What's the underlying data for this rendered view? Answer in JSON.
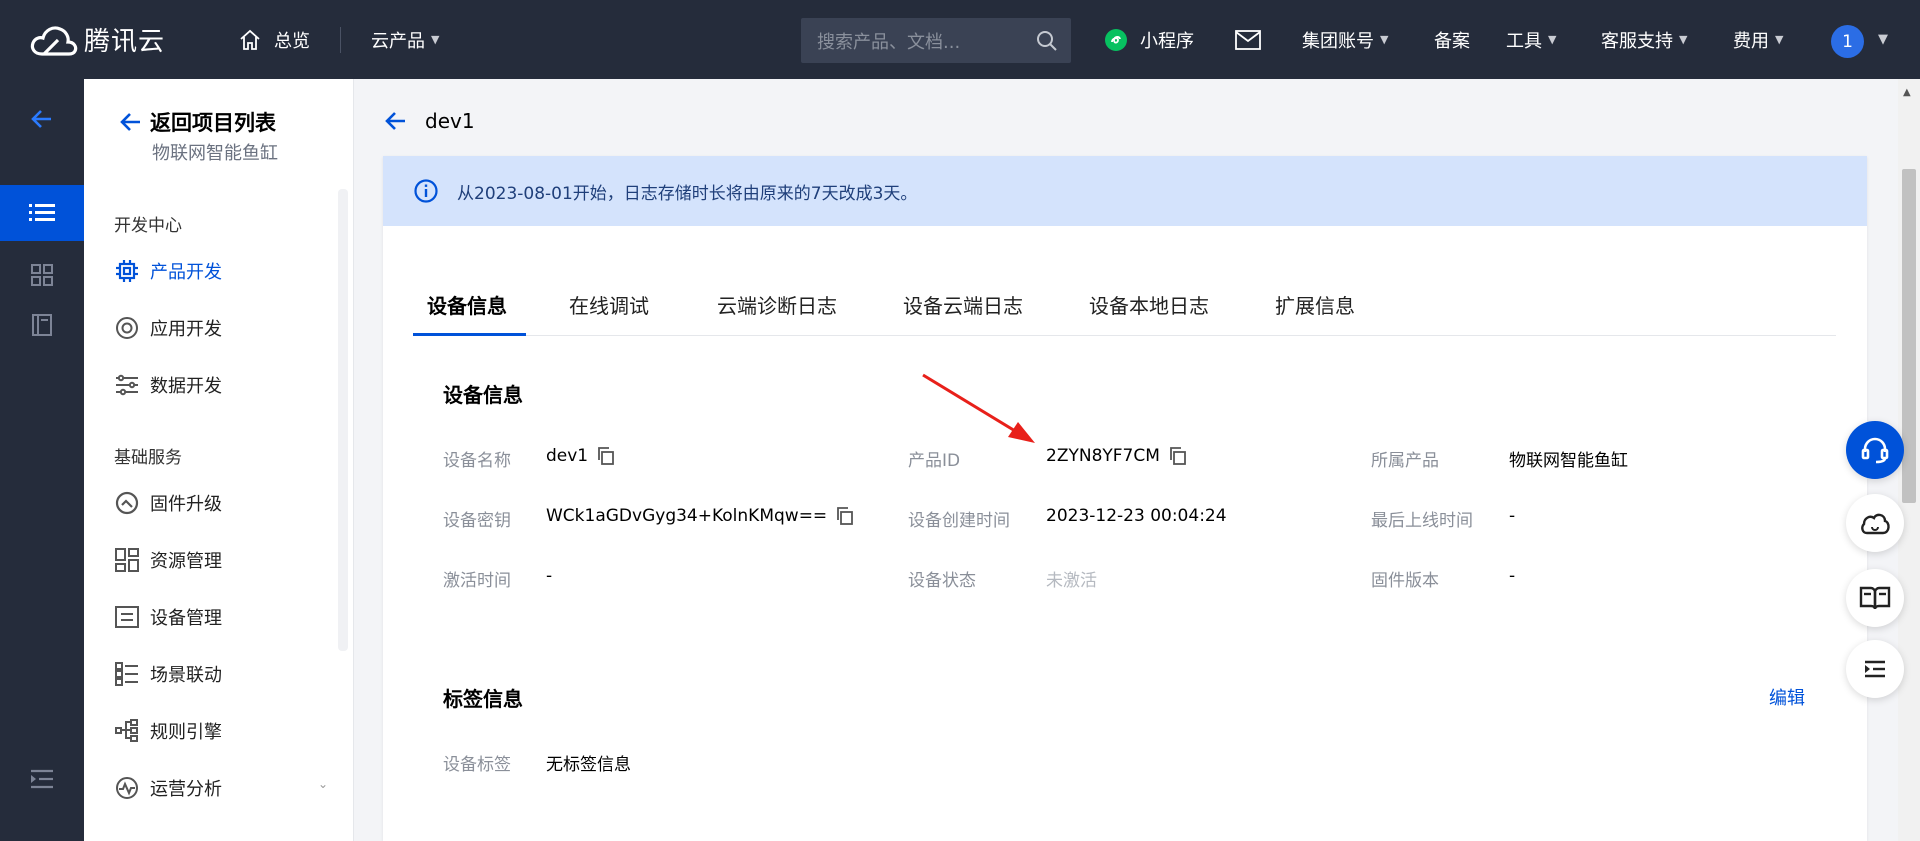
{
  "topnav": {
    "brand": "腾讯云",
    "overview": "总览",
    "products": "云产品",
    "search_placeholder": "搜索产品、文档...",
    "mini_program": "小程序",
    "group_account": "集团账号",
    "record": "备案",
    "tools": "工具",
    "support": "客服支持",
    "billing": "费用",
    "avatar_initial": "1"
  },
  "sidemenu": {
    "back_label": "返回项目列表",
    "project_name": "物联网智能鱼缸",
    "section_dev": "开发中心",
    "section_base": "基础服务",
    "items": [
      {
        "label": "产品开发",
        "icon": "chip-icon",
        "active": true
      },
      {
        "label": "应用开发",
        "icon": "app-dev-icon"
      },
      {
        "label": "数据开发",
        "icon": "data-dev-icon"
      },
      {
        "label": "固件升级",
        "icon": "firmware-icon"
      },
      {
        "label": "资源管理",
        "icon": "resource-icon"
      },
      {
        "label": "设备管理",
        "icon": "device-manage-icon"
      },
      {
        "label": "场景联动",
        "icon": "scene-icon"
      },
      {
        "label": "规则引擎",
        "icon": "rule-icon"
      },
      {
        "label": "运营分析",
        "icon": "analytics-icon"
      }
    ]
  },
  "main": {
    "device_title": "dev1",
    "notice": "从2023-08-01开始，日志存储时长将由原来的7天改成3天。",
    "tabs": [
      "设备信息",
      "在线调试",
      "云端诊断日志",
      "设备云端日志",
      "设备本地日志",
      "扩展信息"
    ],
    "device_info": {
      "title": "设备信息",
      "device_name_label": "设备名称",
      "device_name": "dev1",
      "product_id_label": "产品ID",
      "product_id": "2ZYN8YF7CM",
      "product_label": "所属产品",
      "product": "物联网智能鱼缸",
      "secret_label": "设备密钥",
      "secret": "WCk1aGDvGyg34+KolnKMqw==",
      "created_label": "设备创建时间",
      "created": "2023-12-23 00:04:24",
      "last_online_label": "最后上线时间",
      "last_online": "-",
      "activated_label": "激活时间",
      "activated": "-",
      "status_label": "设备状态",
      "status": "未激活",
      "firmware_label": "固件版本",
      "firmware": "-"
    },
    "tags": {
      "title": "标签信息",
      "edit": "编辑",
      "label": "设备标签",
      "value": "无标签信息"
    }
  },
  "colors": {
    "nav_bg": "#252c3b",
    "primary": "#0052d9",
    "notice_bg": "#d4e3fc",
    "annotation_arrow": "#e8201a"
  }
}
